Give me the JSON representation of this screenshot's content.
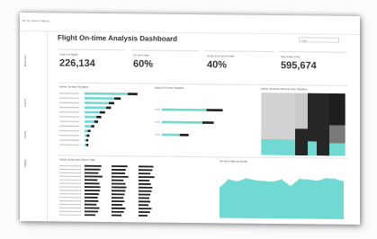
{
  "breadcrumb": "00:16 | Airline Analysis",
  "title": "Flight On-time Analysis Dashboard",
  "filter": {
    "placeholder": "Filter"
  },
  "sidebar": [
    "Overview",
    "Airport",
    "Airline",
    "Flights"
  ],
  "kpis": [
    {
      "label": "Total # of flights",
      "value": "226,134"
    },
    {
      "label": "On-time Rate",
      "value": "60%"
    },
    {
      "label": "Delay and Cancel Rate",
      "value": "40%"
    },
    {
      "label": "Avg Delay (min)",
      "value": "595,674"
    }
  ],
  "panels": {
    "airline_ontime": "Airline On-time Situation",
    "airport_ontime": "Airport On-time Situation",
    "airline_treemap": "Airline Structure with On-time Situation",
    "delay_cancel": "Airline Delay and Cancel Rate",
    "ontime_by_month": "On-time Rate by Month"
  },
  "colors": {
    "accent": "#6fd9d2",
    "dark": "#262626",
    "bar_black": "#1e1e1e",
    "gray": "#c6c6c6",
    "midgray": "#7a7a7a"
  },
  "chart_data": [
    {
      "type": "bar",
      "title": "Airline On-time Situation",
      "series": [
        {
          "values": [
            0.8,
            0.55,
            0.45,
            0.4,
            0.28,
            0.22,
            0.18,
            0.12,
            0.06,
            0.04,
            0.03,
            0.03
          ]
        },
        {
          "values": [
            0.18,
            0.12,
            0.1,
            0.09,
            0.1,
            0.09,
            0.07,
            0.06,
            0.05,
            0.05,
            0.04,
            0.04
          ]
        }
      ]
    },
    {
      "type": "bar",
      "title": "Airport On-time Situation",
      "series": [
        {
          "values": [
            0.55,
            0.5,
            0.22
          ]
        },
        {
          "values": [
            0.2,
            0.14,
            0.11
          ]
        }
      ]
    },
    {
      "type": "bar",
      "title": "Airline Delay and Cancel Rate",
      "series": [
        {
          "values": [
            0.85,
            0.8,
            0.7,
            0.9,
            0.65,
            0.75,
            0.8,
            0.78,
            0.72,
            0.66,
            0.7,
            0.6,
            0.75,
            0.68,
            0.55
          ]
        },
        {
          "values": [
            0.8,
            0.72,
            0.68,
            0.85,
            0.6,
            0.7,
            0.75,
            0.7,
            0.66,
            0.6,
            0.65,
            0.55,
            0.7,
            0.62,
            0.5
          ]
        },
        {
          "values": [
            0.75,
            0.7,
            0.6,
            0.8,
            0.55,
            0.62,
            0.7,
            0.66,
            0.6,
            0.55,
            0.6,
            0.5,
            0.66,
            0.58,
            0.45
          ]
        }
      ]
    },
    {
      "type": "area",
      "title": "On-time Rate by Month",
      "values": [
        0.58,
        0.74,
        0.7,
        0.76,
        0.73,
        0.71,
        0.7,
        0.75,
        0.62,
        0.76,
        0.75,
        0.73,
        0.78,
        0.77,
        0.72
      ]
    }
  ]
}
